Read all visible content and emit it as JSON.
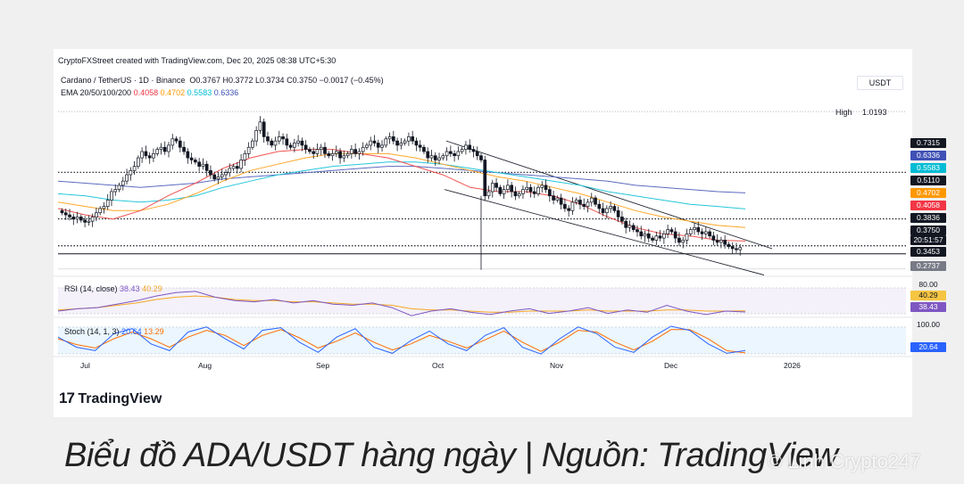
{
  "header": {
    "credit": "CryptoFXStreet created with TradingView.com, Dec 20, 2025 08:38 UTC+5:30",
    "symbol": "Cardano / TetherUS · 1D · Binance",
    "ohlc": {
      "open": "O0.3767",
      "high": "H0.3772",
      "low": "L0.3734",
      "close": "C0.3750",
      "change": "−0.0017 (−0.45%)"
    },
    "ema_label": "EMA 20/50/100/200",
    "ema_values": [
      {
        "value": "0.4058",
        "color": "#f23645"
      },
      {
        "value": "0.4702",
        "color": "#ff9800"
      },
      {
        "value": "0.5583",
        "color": "#00bcd4"
      },
      {
        "value": "0.6336",
        "color": "#3f51b5"
      }
    ],
    "currency": "USDT"
  },
  "chart_data": {
    "type": "candlestick",
    "x_tick_labels": [
      "Jul",
      "Aug",
      "Sep",
      "Oct",
      "Nov",
      "Dec",
      "2026"
    ],
    "high_label": "High",
    "high_value": "1.0193",
    "price_tags": [
      {
        "value": "0.7315",
        "bg": "#131722"
      },
      {
        "value": "0.6336",
        "bg": "#3f51b5"
      },
      {
        "value": "0.5583",
        "bg": "#00bcd4"
      },
      {
        "value": "0.5110",
        "bg": "#131722"
      },
      {
        "value": "0.4702",
        "bg": "#ff9800"
      },
      {
        "value": "0.4058",
        "bg": "#f23645"
      },
      {
        "value": "0.3836",
        "bg": "#131722"
      },
      {
        "value": "0.3750",
        "bg": "#131722"
      },
      {
        "value": "20:51:57",
        "bg": "#131722"
      },
      {
        "value": "0.3453",
        "bg": "#131722"
      },
      {
        "value": "0.2737",
        "bg": "#787b86"
      }
    ],
    "candles_close": [
      0.54,
      0.53,
      0.52,
      0.51,
      0.52,
      0.505,
      0.495,
      0.5,
      0.52,
      0.54,
      0.56,
      0.57,
      0.6,
      0.64,
      0.65,
      0.67,
      0.69,
      0.72,
      0.74,
      0.76,
      0.8,
      0.83,
      0.81,
      0.8,
      0.82,
      0.84,
      0.85,
      0.83,
      0.86,
      0.89,
      0.88,
      0.85,
      0.83,
      0.8,
      0.79,
      0.78,
      0.76,
      0.77,
      0.74,
      0.72,
      0.7,
      0.71,
      0.72,
      0.73,
      0.75,
      0.76,
      0.75,
      0.79,
      0.82,
      0.85,
      0.88,
      0.93,
      0.97,
      0.9,
      0.88,
      0.86,
      0.88,
      0.9,
      0.89,
      0.86,
      0.85,
      0.87,
      0.88,
      0.86,
      0.84,
      0.83,
      0.82,
      0.84,
      0.85,
      0.82,
      0.81,
      0.82,
      0.83,
      0.8,
      0.81,
      0.82,
      0.84,
      0.82,
      0.83,
      0.85,
      0.86,
      0.88,
      0.87,
      0.85,
      0.86,
      0.89,
      0.9,
      0.88,
      0.86,
      0.87,
      0.88,
      0.9,
      0.88,
      0.86,
      0.85,
      0.83,
      0.8,
      0.81,
      0.79,
      0.8,
      0.81,
      0.83,
      0.82,
      0.81,
      0.83,
      0.84,
      0.86,
      0.84,
      0.83,
      0.81,
      0.79,
      0.62,
      0.64,
      0.68,
      0.66,
      0.63,
      0.65,
      0.67,
      0.64,
      0.62,
      0.63,
      0.65,
      0.66,
      0.64,
      0.63,
      0.66,
      0.67,
      0.65,
      0.62,
      0.6,
      0.61,
      0.58,
      0.56,
      0.55,
      0.59,
      0.6,
      0.58,
      0.57,
      0.59,
      0.61,
      0.58,
      0.56,
      0.54,
      0.56,
      0.57,
      0.55,
      0.52,
      0.5,
      0.47,
      0.48,
      0.46,
      0.45,
      0.43,
      0.44,
      0.42,
      0.41,
      0.43,
      0.42,
      0.44,
      0.46,
      0.45,
      0.42,
      0.4,
      0.41,
      0.44,
      0.46,
      0.47,
      0.45,
      0.44,
      0.45,
      0.43,
      0.41,
      0.4,
      0.41,
      0.39,
      0.38,
      0.37,
      0.365,
      0.375
    ],
    "ema20": [
      0.56,
      0.53,
      0.51,
      0.55,
      0.62,
      0.68,
      0.75,
      0.8,
      0.83,
      0.84,
      0.84,
      0.82,
      0.8,
      0.76,
      0.72,
      0.66,
      0.64,
      0.64,
      0.62,
      0.58,
      0.52,
      0.47,
      0.44,
      0.43,
      0.41,
      0.406
    ],
    "ema50": [
      0.59,
      0.57,
      0.55,
      0.55,
      0.58,
      0.63,
      0.69,
      0.74,
      0.77,
      0.8,
      0.82,
      0.82,
      0.82,
      0.8,
      0.77,
      0.74,
      0.71,
      0.69,
      0.66,
      0.63,
      0.59,
      0.55,
      0.52,
      0.5,
      0.48,
      0.47
    ],
    "ema100": [
      0.63,
      0.62,
      0.6,
      0.59,
      0.6,
      0.62,
      0.66,
      0.69,
      0.72,
      0.74,
      0.76,
      0.77,
      0.78,
      0.78,
      0.77,
      0.75,
      0.73,
      0.71,
      0.69,
      0.67,
      0.64,
      0.62,
      0.6,
      0.58,
      0.57,
      0.558
    ],
    "ema200": [
      0.69,
      0.68,
      0.67,
      0.66,
      0.67,
      0.68,
      0.7,
      0.71,
      0.72,
      0.73,
      0.74,
      0.75,
      0.76,
      0.76,
      0.75,
      0.74,
      0.73,
      0.72,
      0.71,
      0.7,
      0.69,
      0.67,
      0.66,
      0.65,
      0.64,
      0.634
    ],
    "rsi": {
      "label": "RSI (14, close)",
      "value": "38.43",
      "ma_value": "40.29",
      "upper_tag": "80.00",
      "line": [
        40,
        44,
        46,
        52,
        58,
        66,
        72,
        74,
        64,
        58,
        56,
        60,
        54,
        58,
        52,
        50,
        54,
        46,
        32,
        40,
        44,
        38,
        34,
        40,
        44,
        36,
        40,
        46,
        36,
        42,
        38,
        50,
        40,
        34,
        40,
        38.4
      ],
      "ma": [
        42,
        44,
        46,
        50,
        54,
        60,
        64,
        66,
        64,
        60,
        58,
        58,
        56,
        56,
        54,
        52,
        52,
        50,
        44,
        42,
        42,
        40,
        38,
        38,
        40,
        40,
        40,
        42,
        40,
        40,
        40,
        42,
        42,
        40,
        40,
        40.3
      ]
    },
    "stoch": {
      "label": "Stoch (14, 1, 3)",
      "k_value": "20.64",
      "d_value": "13.29",
      "upper_tag": "100.00",
      "k": [
        60,
        30,
        20,
        70,
        85,
        40,
        20,
        75,
        90,
        55,
        25,
        80,
        88,
        45,
        15,
        60,
        85,
        30,
        12,
        50,
        78,
        40,
        20,
        65,
        88,
        30,
        10,
        55,
        90,
        70,
        30,
        15,
        60,
        92,
        80,
        40,
        12,
        20.6
      ],
      "d": [
        55,
        38,
        28,
        55,
        75,
        55,
        30,
        60,
        80,
        65,
        35,
        65,
        82,
        58,
        28,
        48,
        72,
        45,
        22,
        40,
        65,
        48,
        28,
        52,
        78,
        45,
        18,
        45,
        80,
        75,
        45,
        22,
        48,
        82,
        82,
        55,
        20,
        13.3
      ]
    }
  },
  "footer": {
    "brand": "TradingView",
    "logo_glyph": "17"
  },
  "caption": "Biểu đồ ADA/USDT hàng ngày | Nguồn: TradingView",
  "watermark": "© Linh Crypto247"
}
